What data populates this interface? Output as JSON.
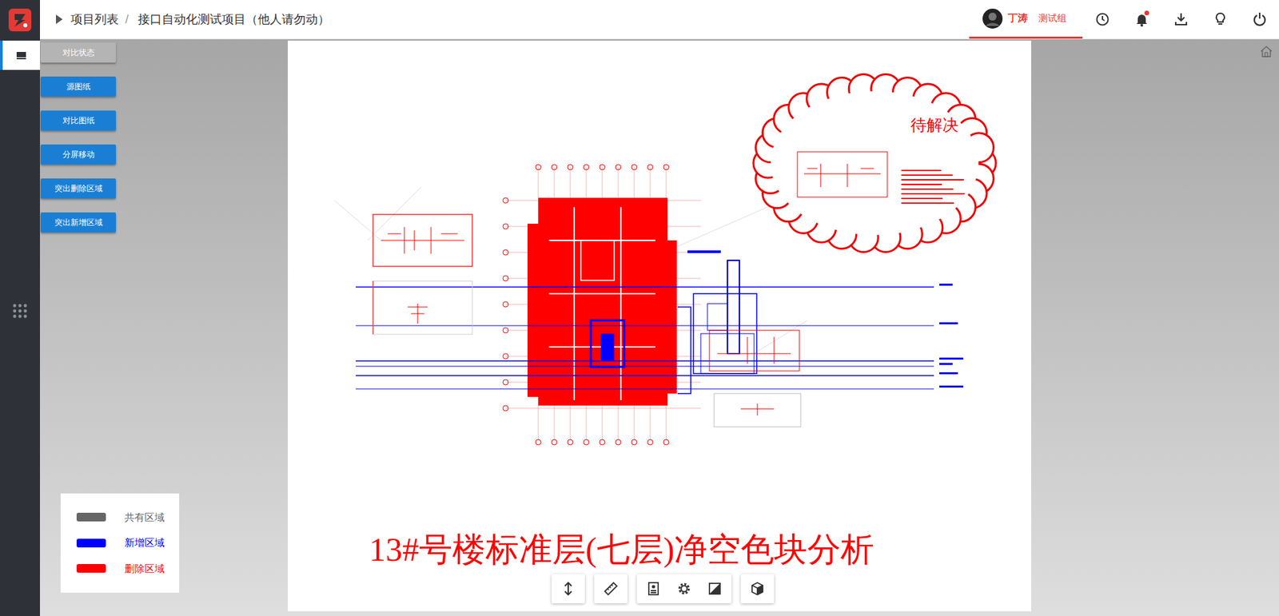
{
  "header": {
    "breadcrumb": [
      {
        "label": "项目列表"
      },
      {
        "label": "接口自动化测试项目（他人请勿动）"
      }
    ],
    "separator": "/"
  },
  "user": {
    "name": "丁涛",
    "group": "测试组"
  },
  "notifications": {
    "unread": true
  },
  "sidebar": {
    "items": [
      {
        "selected": true
      },
      {
        "selected": false
      }
    ]
  },
  "controls": [
    {
      "label": "对比状态",
      "disabled": true
    },
    {
      "label": "源图纸",
      "disabled": false
    },
    {
      "label": "对比图纸",
      "disabled": false
    },
    {
      "label": "分屏移动",
      "disabled": false
    },
    {
      "label": "突出删除区域",
      "disabled": false
    },
    {
      "label": "突出新增区域",
      "disabled": false
    }
  ],
  "legend": [
    {
      "label": "共有区域",
      "color": "#666666"
    },
    {
      "label": "新增区域",
      "color": "#0000ff"
    },
    {
      "label": "删除区域",
      "color": "#ff0000"
    }
  ],
  "drawing": {
    "cloud_label": "待解决",
    "title": "13#号楼标准层(七层)净空色块分析"
  }
}
